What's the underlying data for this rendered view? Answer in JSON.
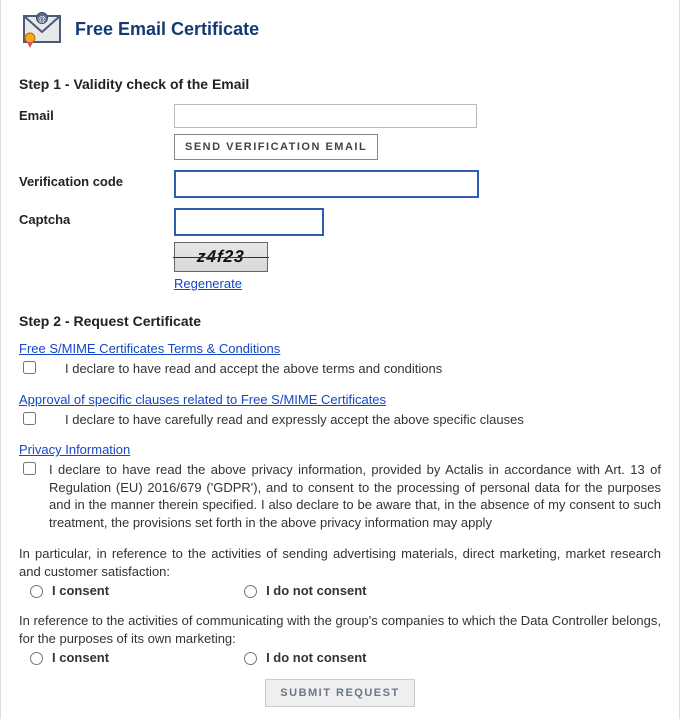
{
  "header": {
    "title": "Free Email Certificate"
  },
  "step1": {
    "heading": "Step 1 - Validity check of the Email",
    "email_label": "Email",
    "send_verification_btn": "SEND VERIFICATION EMAIL",
    "verification_code_label": "Verification code",
    "captcha_label": "Captcha",
    "captcha_text": "z4f23",
    "regenerate_link": "Regenerate"
  },
  "step2": {
    "heading": "Step 2 - Request Certificate",
    "terms_link": "Free S/MIME Certificates Terms & Conditions",
    "terms_check": "I declare to have read and accept the above terms and conditions",
    "clauses_link": "Approval of specific clauses related to Free S/MIME Certificates",
    "clauses_check": "I declare to have carefully read and expressly accept the above specific clauses",
    "privacy_link": "Privacy Information",
    "privacy_check": "I declare to have read the above privacy information, provided by Actalis in accordance with Art. 13 of Regulation (EU) 2016/679 ('GDPR'), and to consent to the processing of personal data for the purposes and in the manner therein specified. I also declare to be aware that, in the absence of my consent to such treatment, the provisions set forth in the above privacy information may apply",
    "marketing1_text": "In particular, in reference to the activities of sending advertising materials, direct marketing, market research and customer satisfaction:",
    "marketing2_text": "In reference to the activities of communicating with the group's companies to which the Data Controller belongs, for the purposes of its own marketing:",
    "consent_label": "I consent",
    "no_consent_label": "I do not consent",
    "submit_btn": "SUBMIT REQUEST"
  }
}
